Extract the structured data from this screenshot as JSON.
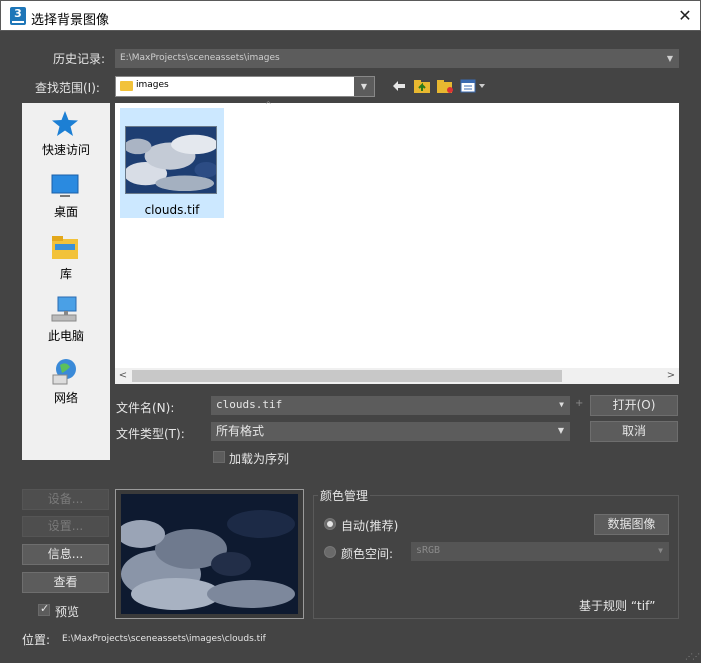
{
  "window": {
    "title": "选择背景图像",
    "close_glyph": "✕"
  },
  "history": {
    "label": "历史记录:",
    "value": "E:\\MaxProjects\\sceneassets\\images",
    "arrow": "▼"
  },
  "look_in": {
    "label": "查找范围(I):",
    "value": "images",
    "arrow": "▼"
  },
  "toolbar": {
    "back_glyph": "🡄"
  },
  "places": [
    {
      "label": "快速访问",
      "icon": "star-icon"
    },
    {
      "label": "桌面",
      "icon": "desktop-icon"
    },
    {
      "label": "库",
      "icon": "library-folder-icon"
    },
    {
      "label": "此电脑",
      "icon": "computer-icon"
    },
    {
      "label": "网络",
      "icon": "network-globe-icon"
    }
  ],
  "files": [
    {
      "name": "clouds.tif",
      "selected": true
    }
  ],
  "file_list": {
    "sort_caret": "^",
    "scroll_left": "<",
    "scroll_right": ">"
  },
  "file_name": {
    "label": "文件名(N):",
    "value": "clouds.tif",
    "arrow": "▼",
    "plus": "+"
  },
  "file_type": {
    "label": "文件类型(T):",
    "value": "所有格式",
    "arrow": "▼"
  },
  "buttons": {
    "open": "打开(O)",
    "cancel": "取消"
  },
  "sequence": {
    "label": "加载为序列",
    "checked": false
  },
  "side_buttons": {
    "devices": "设备...",
    "setup": "设置...",
    "info": "信息...",
    "view": "查看"
  },
  "preview": {
    "label": "预览",
    "checked": true,
    "check_glyph": "✓"
  },
  "color_management": {
    "title": "颜色管理",
    "auto_label": "自动(推荐)",
    "data_image_button": "数据图像",
    "color_space_label": "颜色空间:",
    "color_space_value": "sRGB",
    "arrow": "▼",
    "rule_text": "基于规则 “tif”"
  },
  "location": {
    "label": "位置:",
    "path": "E:\\MaxProjects\\sceneassets\\images\\clouds.tif"
  },
  "resize_grip": "⋰⋰",
  "colors": {
    "accent_selection": "#cce8ff",
    "dialog_bg": "#444444",
    "field_bg": "#5c5c5c",
    "app_icon": "#1e76b8"
  }
}
